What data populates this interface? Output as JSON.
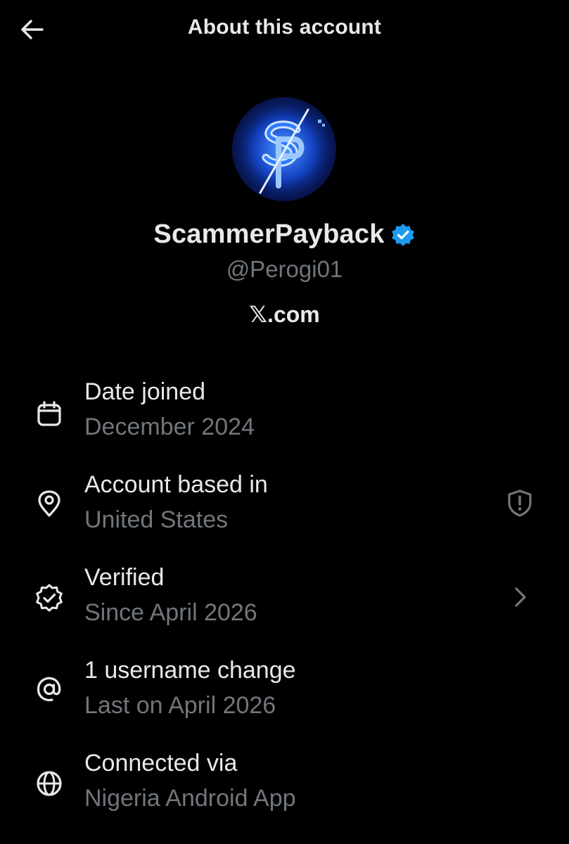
{
  "header": {
    "back_icon": "arrow-left-icon",
    "title": "About this account"
  },
  "profile": {
    "avatar_description_icon": "sp-logo-avatar",
    "display_name": "ScammerPayback",
    "verified_badge_icon": "verified-badge-icon",
    "verified_badge_color": "#1d9bf0",
    "handle": "@Perogi01",
    "source": "𝕏.com"
  },
  "rows": [
    {
      "icon": "calendar-icon",
      "title": "Date joined",
      "subtitle": "December 2024"
    },
    {
      "icon": "location-pin-icon",
      "title": "Account based in",
      "subtitle": "United States",
      "trailing_icon": "shield-alert-icon"
    },
    {
      "icon": "verified-check-icon",
      "title": "Verified",
      "subtitle": "Since April 2026",
      "trailing_icon": "chevron-right-icon"
    },
    {
      "icon": "at-sign-icon",
      "title": "1 username change",
      "subtitle": "Last on April 2026"
    },
    {
      "icon": "globe-icon",
      "title": "Connected via",
      "subtitle": "Nigeria Android App"
    }
  ],
  "colors": {
    "background": "#000000",
    "primary_text": "#e7e9ea",
    "secondary_text": "#71767b"
  }
}
